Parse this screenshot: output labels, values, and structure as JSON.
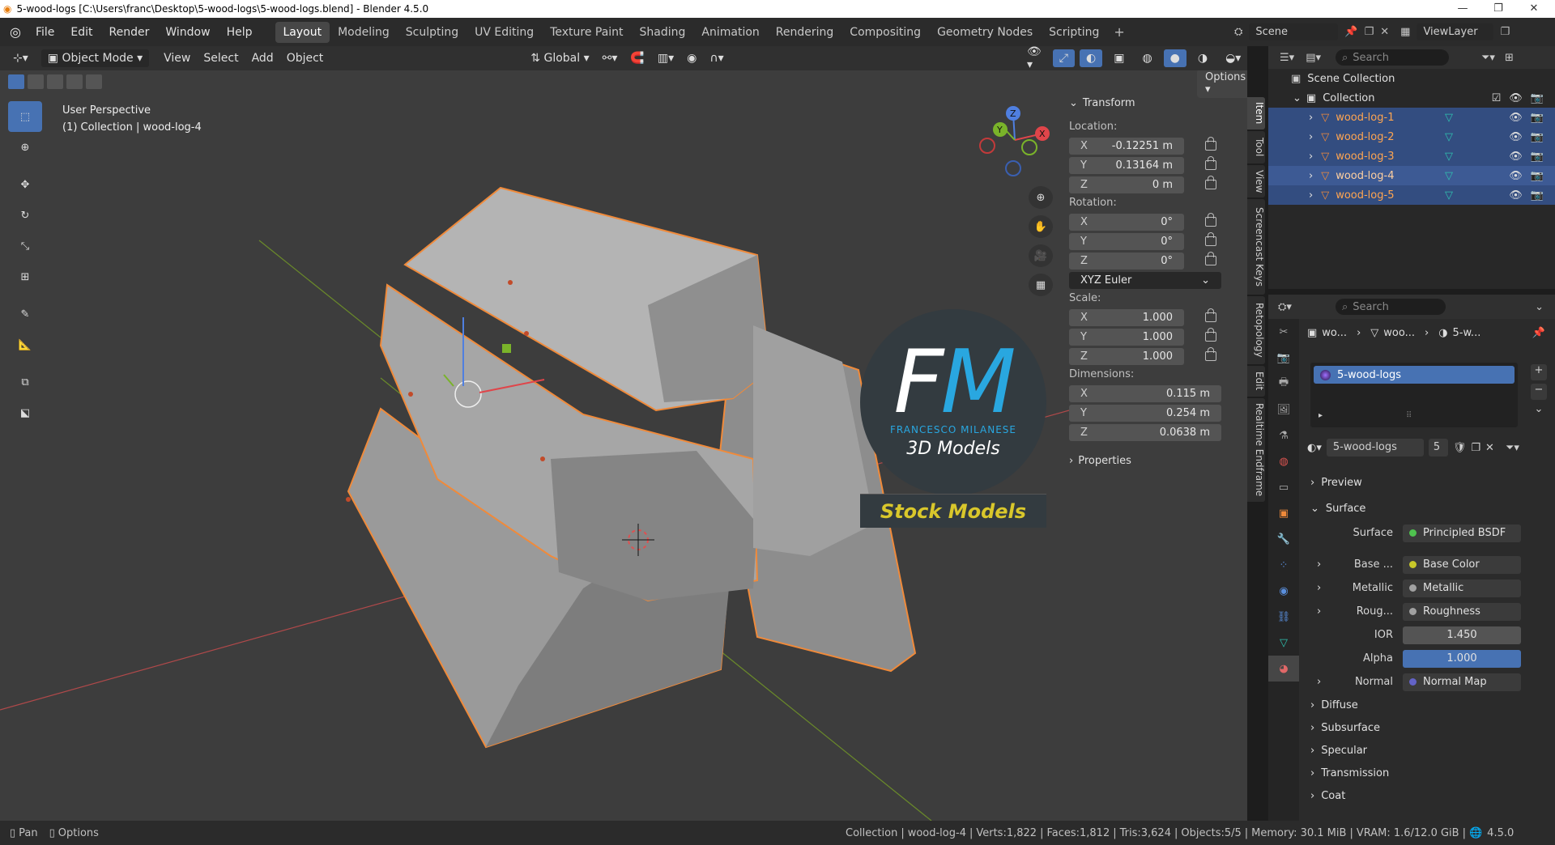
{
  "window": {
    "title": "5-wood-logs [C:\\Users\\franc\\Desktop\\5-wood-logs\\5-wood-logs.blend] - Blender 4.5.0"
  },
  "menu": [
    "File",
    "Edit",
    "Render",
    "Window",
    "Help"
  ],
  "workspaces": [
    "Layout",
    "Modeling",
    "Sculpting",
    "UV Editing",
    "Texture Paint",
    "Shading",
    "Animation",
    "Rendering",
    "Compositing",
    "Geometry Nodes",
    "Scripting"
  ],
  "active_workspace": "Layout",
  "scene": {
    "name": "Scene",
    "view_layer": "ViewLayer"
  },
  "header3d": {
    "mode": "Object Mode",
    "view": "View",
    "select": "Select",
    "add": "Add",
    "object": "Object",
    "orientation": "Global",
    "options": "Options"
  },
  "viewport": {
    "perspective": "User Perspective",
    "collection_info": "(1) Collection | wood-log-4"
  },
  "gizmo_axes": [
    "X",
    "Y",
    "Z"
  ],
  "npanel": {
    "transform_title": "Transform",
    "location_label": "Location:",
    "location": {
      "x": "-0.12251 m",
      "y": "0.13164 m",
      "z": "0 m"
    },
    "rotation_label": "Rotation:",
    "rotation": {
      "x": "0°",
      "y": "0°",
      "z": "0°"
    },
    "rotation_mode": "XYZ Euler",
    "scale_label": "Scale:",
    "scale": {
      "x": "1.000",
      "y": "1.000",
      "z": "1.000"
    },
    "dimensions_label": "Dimensions:",
    "dimensions": {
      "x": "0.115 m",
      "y": "0.254 m",
      "z": "0.0638 m"
    },
    "properties_title": "Properties",
    "axis_labels": {
      "x": "X",
      "y": "Y",
      "z": "Z"
    }
  },
  "side_tabs": [
    "Item",
    "Tool",
    "View",
    "Screencast Keys",
    "Retopology",
    "Edit",
    "Realtime Endframe"
  ],
  "logo": {
    "initials": "FM",
    "name": "FRANCESCO MILANESE",
    "tagline": "3D Models",
    "banner": "Stock Models"
  },
  "outliner": {
    "search_placeholder": "Search",
    "scene_collection": "Scene Collection",
    "collection": "Collection",
    "objects": [
      "wood-log-1",
      "wood-log-2",
      "wood-log-3",
      "wood-log-4",
      "wood-log-5"
    ]
  },
  "properties": {
    "search_placeholder": "Search",
    "breadcrumb": [
      "wo...",
      "woo...",
      "5-w..."
    ],
    "material_slot": "5-wood-logs",
    "material_name": "5-wood-logs",
    "material_users": "5",
    "sections": {
      "preview": "Preview",
      "surface": "Surface"
    },
    "surface_shader_label": "Surface",
    "surface_shader": "Principled BSDF",
    "inputs": [
      {
        "label": "Base ...",
        "value": "Base Color",
        "dot": "#c7c729"
      },
      {
        "label": "Metallic",
        "value": "Metallic",
        "dot": "#a1a1a1"
      },
      {
        "label": "Roug...",
        "value": "Roughness",
        "dot": "#a1a1a1"
      }
    ],
    "ior_label": "IOR",
    "ior": "1.450",
    "alpha_label": "Alpha",
    "alpha": "1.000",
    "normal_label": "Normal",
    "normal": "Normal Map",
    "subsections": [
      "Diffuse",
      "Subsurface",
      "Specular",
      "Transmission",
      "Coat"
    ]
  },
  "status": {
    "left": [
      "Pan",
      "Options"
    ],
    "collection": "Collection",
    "object": "wood-log-4",
    "verts": "Verts:1,822",
    "faces": "Faces:1,812",
    "tris": "Tris:3,624",
    "objects": "Objects:5/5",
    "memory": "Memory: 30.1 MiB",
    "vram": "VRAM: 1.6/12.0 GiB",
    "version": "4.5.0"
  },
  "colors": {
    "accent": "#4772b3",
    "selection_outline": "#f08a3a",
    "outliner_selected": "#334d80",
    "logo_blue": "#29a7e0",
    "logo_yellow": "#d9c72b"
  }
}
